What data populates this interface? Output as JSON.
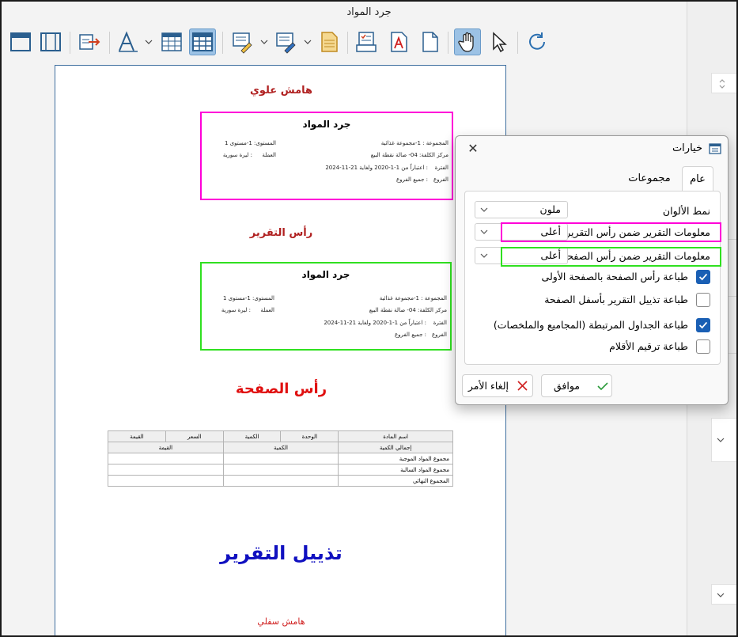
{
  "window": {
    "title": "جرد المواد"
  },
  "toolbar": {
    "buttons": [
      {
        "name": "page-layout-icon"
      },
      {
        "name": "margins-icon"
      },
      {
        "name": "export-icon"
      },
      {
        "name": "font-icon"
      },
      {
        "name": "table-style-icon"
      },
      {
        "name": "grid-icon"
      },
      {
        "name": "edit-report-icon"
      },
      {
        "name": "edit-page-icon"
      },
      {
        "name": "document-icon"
      },
      {
        "name": "print-form-icon"
      },
      {
        "name": "pdf-icon"
      },
      {
        "name": "page-icon"
      },
      {
        "name": "hand-tool-icon"
      },
      {
        "name": "pointer-icon"
      },
      {
        "name": "refresh-icon"
      }
    ]
  },
  "page": {
    "top_margin": "هامش علوي",
    "report_header_label": "رأس التقرير",
    "page_header_label": "رأس الصفحة",
    "report_footer_label": "تذييل التقرير",
    "bottom_margin": "هامش سفلي",
    "header_block": {
      "title": "جرد المواد",
      "group": "المجموعة   : 1-مجموعة غذائية",
      "level": "المستوى: 1-مستوى 1",
      "cost_center": "مركز الكلفة: 04- صالة نقطة البيع",
      "currency_label": "العملة",
      "currency_value": ": ليرة سورية",
      "period_label": "الفترة",
      "period_value": ": اعتباراً من 1-1-2020 ولغاية 21-11-2024",
      "branches_label": "الفروع",
      "branches_value": ": جميع الفروع"
    },
    "table": {
      "headers": [
        "اسم المادة",
        "الوحدة",
        "الكمية",
        "السعر",
        "القيمة"
      ],
      "subheaders": [
        "إجمالي الكمية",
        "الكمية",
        "القيمة"
      ],
      "rows": [
        "مجموع المواد الموجبة",
        "مجموع المواد السالبة",
        "المجموع النهائي"
      ]
    }
  },
  "dialog": {
    "title": "خيارات",
    "close": "✕",
    "tabs": [
      "عام",
      "مجموعات"
    ],
    "color_mode_label": "نمط الألوان",
    "color_mode_value": "ملون",
    "report_info_label": "معلومات التقرير ضمن رأس التقرير",
    "report_info_value": "أعلى",
    "page_info_label": "معلومات التقرير ضمن رأس الصفحة",
    "page_info_value": "أعلى",
    "checkboxes": [
      {
        "label": "طباعة رأس الصفحة بالصفحة الأولى",
        "checked": true
      },
      {
        "label": "طباعة تذييل التقرير بأسفل الصفحة",
        "checked": false
      },
      {
        "label": "طباعة الجداول المرتبطة (المجاميع والملخصات)",
        "checked": true
      },
      {
        "label": "طباعة ترقيم الأقلام",
        "checked": false
      }
    ],
    "ok_label": "موافق",
    "cancel_label": "إلغاء الأمر"
  }
}
